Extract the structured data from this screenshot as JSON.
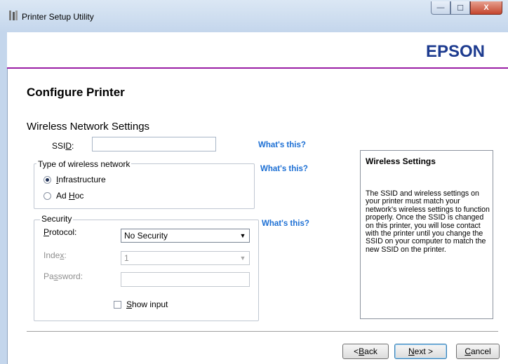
{
  "window": {
    "title": "Printer Setup Utility",
    "controls": {
      "minimize": "—",
      "maximize": "☐",
      "close": "X"
    }
  },
  "header": {
    "brand": "EPSON",
    "brand_color": "#1d3b8f",
    "accent_line_color": "#9a1ea5"
  },
  "page": {
    "title": "Configure Printer",
    "section_title": "Wireless Network Settings"
  },
  "ssid": {
    "label_pre": "SSI",
    "label_underline": "D",
    "label_post": ":",
    "value": "",
    "help": "What's this?"
  },
  "network_type": {
    "legend": "Type of wireless network",
    "help": "What's this?",
    "options": [
      {
        "pre": "",
        "underline": "I",
        "post": "nfrastructure",
        "selected": true
      },
      {
        "pre": "Ad ",
        "underline": "H",
        "post": "oc",
        "selected": false
      }
    ]
  },
  "security": {
    "legend": "Security",
    "help": "What's this?",
    "protocol": {
      "label_pre": "",
      "label_underline": "P",
      "label_post": "rotocol:",
      "value": "No Security",
      "arrow": "▼",
      "enabled": true
    },
    "index": {
      "label_pre": "Inde",
      "label_underline": "x",
      "label_post": ":",
      "value": "1",
      "arrow": "▼",
      "enabled": false
    },
    "password": {
      "label_pre": "Pa",
      "label_underline": "s",
      "label_post": "sword:",
      "value": "",
      "enabled": false
    },
    "show_input": {
      "label_pre": "",
      "label_underline": "S",
      "label_post": "how input",
      "checked": false
    }
  },
  "info_panel": {
    "title": "Wireless Settings",
    "text": "The SSID and wireless settings on your printer must match your network's wireless settings to function properly. Once the SSID is changed on this printer, you will lose contact with the printer until you change the SSID on your computer to match the new SSID on the printer."
  },
  "buttons": {
    "back": {
      "pre": "< ",
      "underline": "B",
      "post": "ack"
    },
    "next": {
      "pre": "",
      "underline": "N",
      "post": "ext >"
    },
    "cancel": {
      "pre": "",
      "underline": "C",
      "post": "ancel"
    }
  },
  "colors": {
    "link": "#1c6fd4"
  }
}
